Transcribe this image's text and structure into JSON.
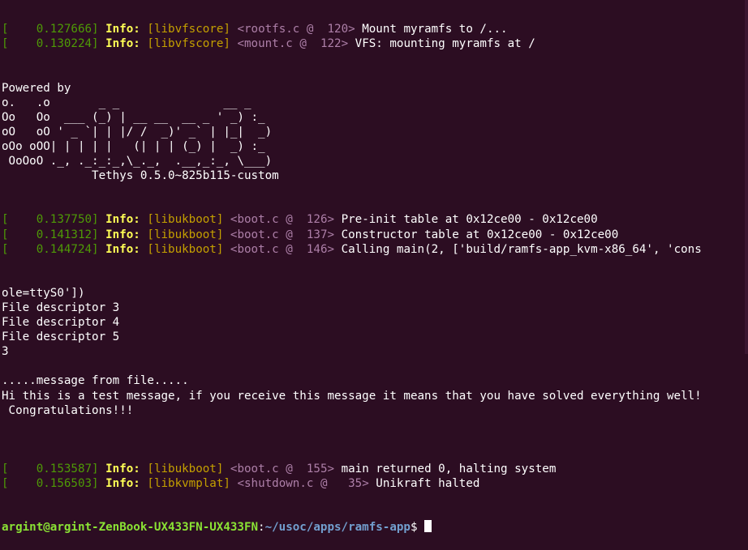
{
  "log_top": [
    {
      "ts": "    0.127666",
      "level": "Info:",
      "lib": "[libvfscore]",
      "loc": "<rootfs.c @  120>",
      "msg": " Mount myramfs to /..."
    },
    {
      "ts": "    0.130224",
      "level": "Info:",
      "lib": "[libvfscore]",
      "loc": "<mount.c @  122>",
      "msg": " VFS: mounting myramfs at /"
    }
  ],
  "banner": [
    "Powered by",
    "o.   .o       _ _               __ _",
    "Oo   Oo  ___ (_) | __ __  __ _ ' _) :_",
    "oO   oO ' _ `| | |/ /  _)' _` | |_|  _)",
    "oOo oOO| | | | |   (| | | (_) |  _) :_",
    " OoOoO ._, ._:_:_,\\_._,  .__,_:_, \\___)",
    "             Tethys 0.5.0~825b115-custom"
  ],
  "log_mid": [
    {
      "ts": "    0.137750",
      "level": "Info:",
      "lib": "[libukboot]",
      "loc": "<boot.c @  126>",
      "msg": " Pre-init table at 0x12ce00 - 0x12ce00"
    },
    {
      "ts": "    0.141312",
      "level": "Info:",
      "lib": "[libukboot]",
      "loc": "<boot.c @  137>",
      "msg": " Constructor table at 0x12ce00 - 0x12ce00"
    },
    {
      "ts": "    0.144724",
      "level": "Info:",
      "lib": "[libukboot]",
      "loc": "<boot.c @  146>",
      "msg": " Calling main(2, ['build/ramfs-app_kvm-x86_64', 'cons"
    }
  ],
  "output": [
    "ole=ttyS0'])",
    "File descriptor 3",
    "File descriptor 4",
    "File descriptor 5",
    "3",
    "",
    ".....message from file.....",
    "Hi this is a test message, if you receive this message it means that you have solved everything well!",
    " Congratulations!!!",
    ""
  ],
  "log_bottom": [
    {
      "ts": "    0.153587",
      "level": "Info:",
      "lib": "[libukboot]",
      "loc": "<boot.c @  155>",
      "msg": " main returned 0, halting system"
    },
    {
      "ts": "    0.156503",
      "level": "Info:",
      "lib": "[libkvmplat]",
      "loc": "<shutdown.c @   35>",
      "msg": " Unikraft halted"
    }
  ],
  "prompt": {
    "user": "argint@argint-ZenBook-UX433FN-UX433FN",
    "sep": ":",
    "path": "~/usoc/apps/ramfs-app",
    "suffix": "$ "
  },
  "colors": {
    "background": "#2c0d22",
    "timestamp": "#4e9a06",
    "info": "#ffff55",
    "library": "#c4a000",
    "location": "#ad7fa8",
    "prompt_user": "#8ae234",
    "prompt_path": "#729fcf"
  }
}
